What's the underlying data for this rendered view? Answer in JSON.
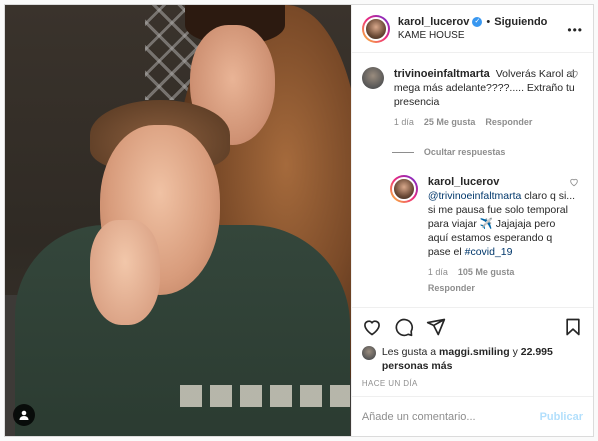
{
  "header": {
    "username": "karol_lucerov",
    "verified_mark": "✓",
    "separator": "•",
    "follow_state": "Siguiendo",
    "location": "KAME HOUSE",
    "more_label": "•••"
  },
  "comments": [
    {
      "username": "trivinoeinfaltmarta",
      "text": "Volverás Karol al mega más adelante????..... Extraño tu presencia",
      "time": "1 día",
      "likes": "25 Me gusta",
      "reply_label": "Responder"
    }
  ],
  "replies_toggle": "Ocultar respuestas",
  "reply": {
    "username": "karol_lucerov",
    "mention": "@trivinoeinfaltmarta",
    "text": "claro q si... si me pausa fue solo temporal para viajar ✈️ Jajajaja pero aquí estamos esperando q pase el",
    "hashtag": "#covid_19",
    "time": "1 día",
    "likes": "105 Me gusta",
    "reply_label": "Responder"
  },
  "likes": {
    "prefix": "Les gusta a",
    "user": "maggi.smiling",
    "connector": "y",
    "count": "22.995 personas más"
  },
  "timestamp": "HACE UN DÍA",
  "add_comment": {
    "placeholder": "Añade un comentario...",
    "publish_label": "Publicar"
  },
  "colors": {
    "link": "#00376b",
    "muted": "#8e8e8e",
    "publish_disabled": "#b2dffc",
    "verified": "#3897f0"
  },
  "icons": [
    "heart-icon",
    "comment-icon",
    "share-icon",
    "bookmark-icon",
    "more-icon",
    "user-tag-icon"
  ]
}
